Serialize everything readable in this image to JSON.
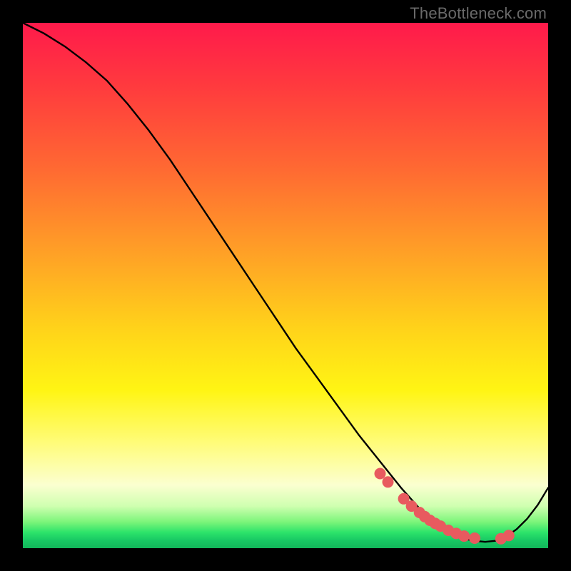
{
  "watermark": "TheBottleneck.com",
  "colors": {
    "dot": "#e85a5f",
    "line": "#000000"
  },
  "chart_data": {
    "type": "line",
    "title": "",
    "xlabel": "",
    "ylabel": "",
    "xlim": [
      0,
      100
    ],
    "ylim": [
      0,
      100
    ],
    "series": [
      {
        "name": "curve",
        "x": [
          0,
          4,
          8,
          12,
          16,
          20,
          24,
          28,
          32,
          36,
          40,
          44,
          48,
          52,
          56,
          60,
          64,
          68,
          72,
          76,
          78,
          80,
          82,
          84,
          86,
          88,
          90,
          92,
          94,
          96,
          98,
          100
        ],
        "y": [
          100,
          98,
          95.5,
          92.5,
          89,
          84.5,
          79.5,
          74,
          68,
          62,
          56,
          50,
          44,
          38,
          32.5,
          27,
          21.5,
          16.5,
          11.5,
          7.0,
          5.0,
          3.5,
          2.5,
          1.8,
          1.4,
          1.2,
          1.4,
          2.2,
          3.6,
          5.6,
          8.2,
          11.5
        ]
      }
    ],
    "markers": {
      "name": "highlight-dots",
      "x": [
        68.0,
        69.5,
        72.5,
        74.0,
        75.5,
        76.5,
        77.5,
        78.5,
        79.5,
        81.0,
        82.5,
        84.0,
        86.0,
        91.0,
        92.5
      ],
      "y": [
        14.2,
        12.6,
        9.4,
        8.0,
        6.8,
        6.0,
        5.3,
        4.7,
        4.2,
        3.4,
        2.8,
        2.3,
        1.9,
        1.8,
        2.4
      ]
    }
  }
}
